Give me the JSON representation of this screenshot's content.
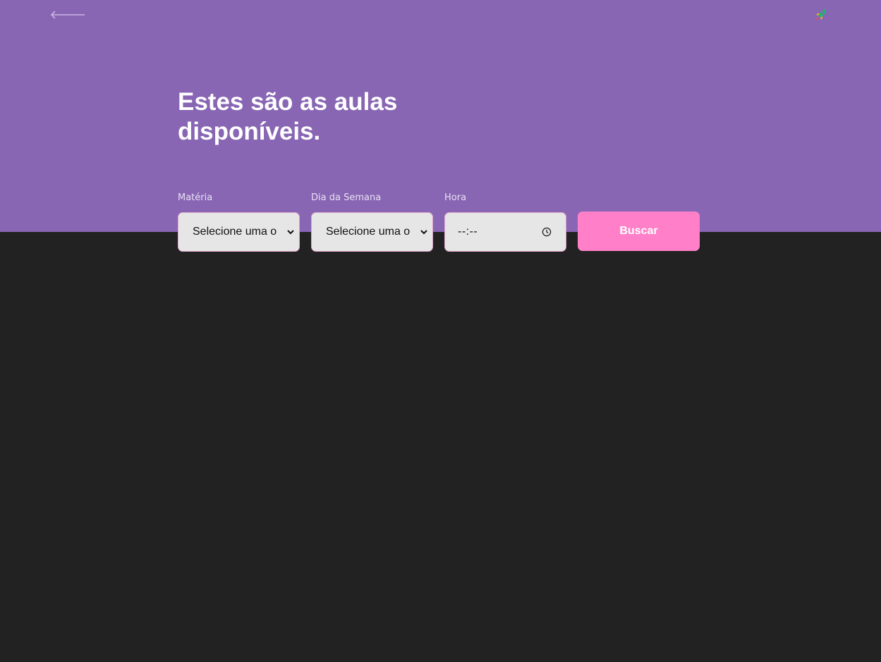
{
  "header": {
    "back_icon": "arrow-left-icon",
    "logo_icon": "rocket-icon",
    "title": "Estes são as aulas disponíveis.",
    "background_color": "#8866b3"
  },
  "filters": {
    "subject": {
      "label": "Matéria",
      "value": "Selecione uma o"
    },
    "weekday": {
      "label": "Dia da Semana",
      "value": "Selecione uma o"
    },
    "time": {
      "label": "Hora",
      "value": "--:--",
      "icon": "clock-icon"
    },
    "search_button": {
      "label": "Buscar",
      "color": "#ff80c8"
    }
  },
  "page": {
    "background_color": "#222222"
  }
}
